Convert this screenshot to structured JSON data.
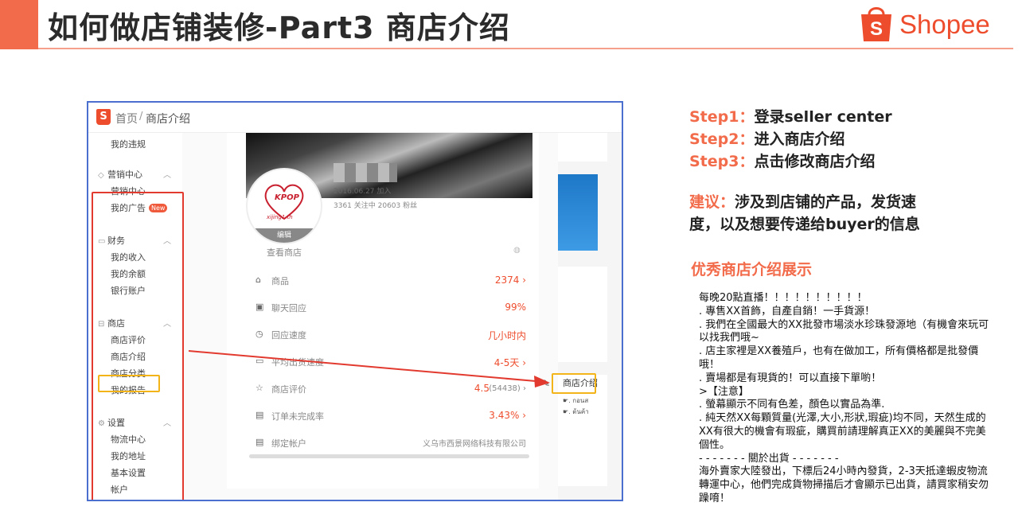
{
  "slide": {
    "title": "如何做店铺装修-Part3 商店介绍",
    "logo_text": "Shopee",
    "accent_color": "#f26b4a",
    "brand_color": "#ee4d2d"
  },
  "screenshot": {
    "logo_letter": "S",
    "breadcrumb_home": "首页",
    "breadcrumb_sep": "/",
    "breadcrumb_current": "商店介绍",
    "sidebar": {
      "top_item": "我的违规",
      "sections": [
        {
          "title": "营销中心",
          "icon": "tag-icon",
          "items": [
            "营销中心",
            "我的广告"
          ],
          "badge": "New"
        },
        {
          "title": "财务",
          "icon": "wallet-icon",
          "items": [
            "我的收入",
            "我的余额",
            "银行账户"
          ]
        },
        {
          "title": "商店",
          "icon": "store-icon",
          "items": [
            "商店评价",
            "商店介绍",
            "商店分类",
            "我的报告"
          ]
        },
        {
          "title": "设置",
          "icon": "gear-icon",
          "items": [
            "物流中心",
            "我的地址",
            "基本设置",
            "帐户"
          ]
        }
      ]
    },
    "shop": {
      "avatar_brand": "KPOP",
      "avatar_sub": "xijing1.th",
      "avatar_edit": "编辑",
      "joined": "2016.06.27 加入",
      "followers": "3361 关注中 20603 粉丝",
      "view_shop": "查看商店",
      "stats": [
        {
          "icon": "store-icon",
          "label": "商品",
          "value": "2374 ›"
        },
        {
          "icon": "chat-icon",
          "label": "聊天回应",
          "value": "99%"
        },
        {
          "icon": "clock-icon",
          "label": "回应速度",
          "value": "几小时内"
        },
        {
          "icon": "truck-icon",
          "label": "平均出货速度",
          "value": "4-5天 ›"
        },
        {
          "icon": "star-icon",
          "label": "商店评价",
          "value": "4.5",
          "extra": "(54438) ›"
        },
        {
          "icon": "clipboard-icon",
          "label": "订单未完成率",
          "value": "3.43% ›"
        },
        {
          "icon": "clipboard-icon",
          "label": "绑定帐户",
          "value": "义乌市西景网络科技有限公司"
        }
      ]
    },
    "right_panel": {
      "label": "商店介绍",
      "line1": "☛. กอนส",
      "line2": "☛. ต้นค้า"
    }
  },
  "steps": [
    {
      "label": "Step1：",
      "text": "登录seller center"
    },
    {
      "label": "Step2：",
      "text": "进入商店介绍"
    },
    {
      "label": "Step3：",
      "text": "点击修改商店介绍"
    }
  ],
  "advice": {
    "label": "建议：",
    "text": "涉及到店铺的产品，发货速度，以及想要传递给buyer的信息"
  },
  "showcase_title": "优秀商店介绍展示",
  "example_lines": [
    "每晚20點直播！！！！！！！！！！",
    ". 專售XX首飾，自產自銷！一手貨源！",
    ". 我們在全國最大的XX批發市場淡水珍珠發源地（有機會來玩可以找我們哦~",
    ". 店主家裡是XX養殖戶，也有在做加工，所有價格都是批發價哦！",
    ". 賣場都是有現貨的！可以直接下單喲！",
    ">【注意】",
    ". 螢幕顯示不同有色差，顏色以實品為準.",
    ". 純天然XX每顆質量(光澤,大小,形狀,瑕疵)均不同，天然生成的XX有很大的機會有瑕疵，購買前請理解真正XX的美麗與不完美個性。",
    "- - - - - - - 關於出貨 - - - - - - -",
    "海外賣家大陸發出，下標后24小時內發貨，2-3天抵達蝦皮物流轉運中心，他們完成貨物掃描后才會顯示已出貨，請買家稍安勿躁唷！"
  ]
}
